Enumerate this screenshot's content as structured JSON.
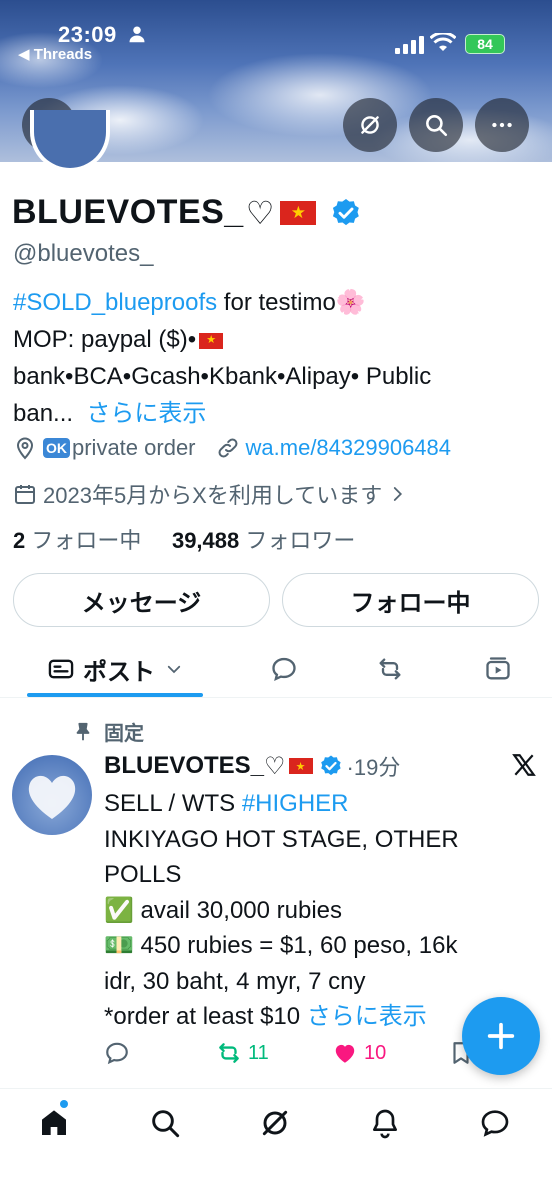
{
  "status_bar": {
    "time": "23:09",
    "back_app": "◀ Threads",
    "battery": "84"
  },
  "profile": {
    "display_name": "BLUEVOTES_",
    "handle": "@bluevotes_",
    "bio": {
      "hashtag": "#SOLD_blueproofs",
      "line1_rest": " for testimo🌸",
      "line2": "MOP: paypal ($)•",
      "line3": "bank•BCA•Gcash•Kbank•Alipay• Public",
      "line4": "ban...",
      "show_more": "さらに表示"
    },
    "location": "private order",
    "location_badge": "OK",
    "website": "wa.me/84329906484",
    "joined": "2023年5月からXを利用しています",
    "following_count": "2",
    "following_label": "フォロー中",
    "followers_count": "39,488",
    "followers_label": "フォロワー"
  },
  "buttons": {
    "message": "メッセージ",
    "following": "フォロー中"
  },
  "tabs": {
    "posts": "ポスト"
  },
  "post": {
    "pinned_label": "固定",
    "author": "BLUEVOTES_",
    "time": "·19分",
    "line1_prefix": "SELL / WTS ",
    "line1_hashtag": "#HIGHER",
    "line2": "INKIYAGO HOT STAGE, OTHER",
    "line3": "POLLS",
    "line4": "✅ avail  30,000 rubies",
    "line5": "💵 450 rubies = $1, 60 peso, 16k",
    "line6": "idr, 30 baht, 4 myr, 7 cny",
    "line7": "*order at least $10 ",
    "show_more": "さらに表示",
    "reposts": "11",
    "likes": "10"
  },
  "colors": {
    "accent": "#1d9bf0",
    "repost_green": "#00ba7c",
    "like_pink": "#f91880",
    "secondary_text": "#536471"
  }
}
